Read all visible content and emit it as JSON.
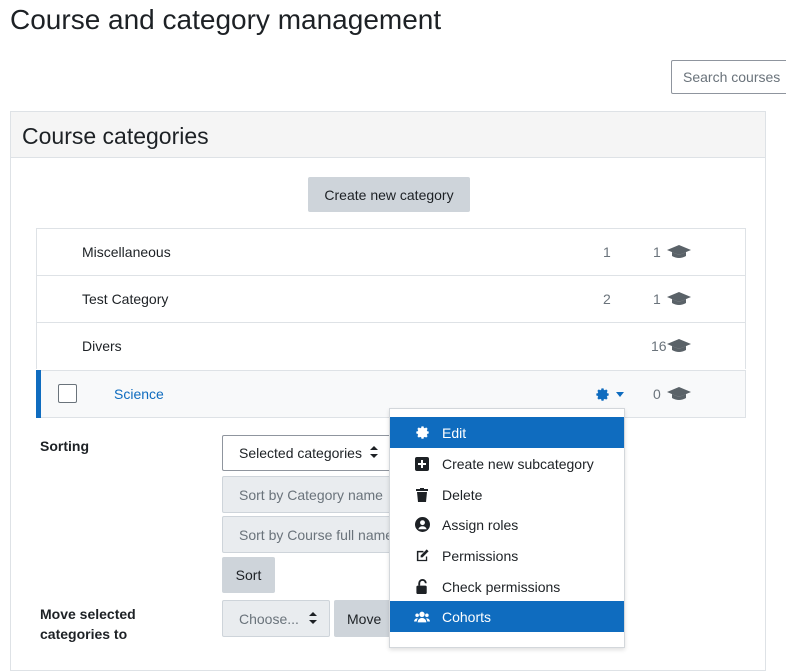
{
  "page": {
    "title": "Course and category management"
  },
  "search": {
    "placeholder": "Search courses"
  },
  "panel": {
    "title": "Course categories",
    "create_label": "Create new category"
  },
  "categories": [
    {
      "name": "Miscellaneous",
      "subcategories": "1",
      "courses": "1"
    },
    {
      "name": "Test Category",
      "subcategories": "2",
      "courses": "1"
    },
    {
      "name": "Divers",
      "subcategories": "",
      "courses": "16"
    },
    {
      "name": "Science",
      "subcategories": "",
      "courses": "0",
      "selected": true
    }
  ],
  "sorting": {
    "label": "Sorting",
    "scope_value": "Selected categories",
    "sort_category_value": "Sort by Category name",
    "sort_course_value": "Sort by Course full name",
    "sort_button": "Sort"
  },
  "move": {
    "label": "Move selected categories to",
    "choose_value": "Choose...",
    "button": "Move"
  },
  "action_menu": {
    "items": [
      {
        "label": "Edit",
        "icon": "cog-icon",
        "active": true
      },
      {
        "label": "Create new subcategory",
        "icon": "plus-square-icon",
        "active": false
      },
      {
        "label": "Delete",
        "icon": "trash-icon",
        "active": false
      },
      {
        "label": "Assign roles",
        "icon": "user-circle-icon",
        "active": false
      },
      {
        "label": "Permissions",
        "icon": "pencil-square-icon",
        "active": false
      },
      {
        "label": "Check permissions",
        "icon": "unlock-icon",
        "active": false
      },
      {
        "label": "Cohorts",
        "icon": "users-icon",
        "active": true
      }
    ]
  },
  "colors": {
    "accent": "#0f6cbf",
    "button_grey": "#ced4da",
    "header_bg": "#f5f5f5"
  }
}
